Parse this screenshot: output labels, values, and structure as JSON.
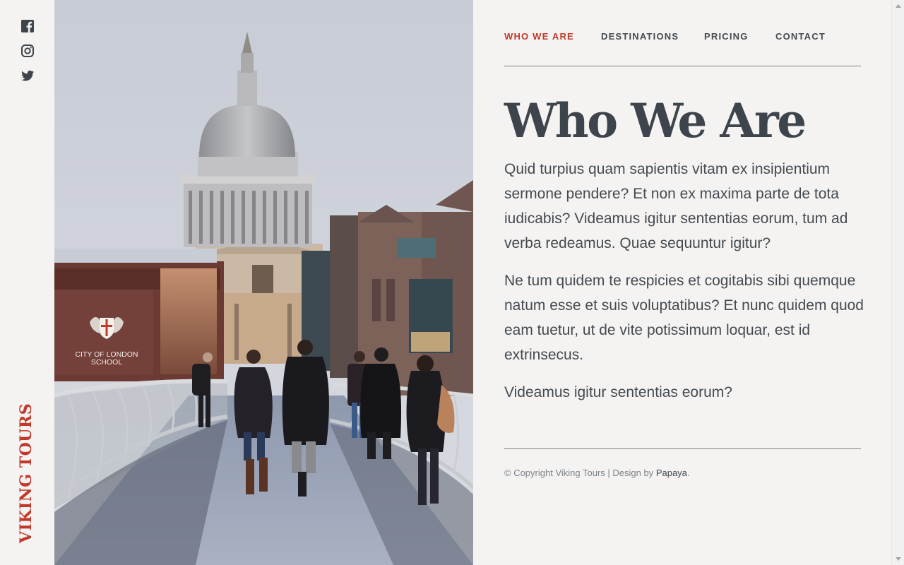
{
  "brand": {
    "name": "VIKING TOURS",
    "color": "#c0392b"
  },
  "social": [
    {
      "icon": "facebook-icon"
    },
    {
      "icon": "instagram-icon"
    },
    {
      "icon": "twitter-icon"
    }
  ],
  "hero": {
    "sign_line1": "CITY OF LONDON",
    "sign_line2": "SCHOOL"
  },
  "nav": {
    "items": [
      {
        "label": "WHO WE ARE",
        "active": true
      },
      {
        "label": "DESTINATIONS",
        "active": false
      },
      {
        "label": "PRICING",
        "active": false
      },
      {
        "label": "CONTACT",
        "active": false
      }
    ]
  },
  "main": {
    "title": "Who We Are",
    "paragraphs": [
      "Quid turpius quam sapientis vitam ex insipientium sermone pendere? Et non ex maxima parte de tota iudicabis? Videamus igitur sententias eorum, tum ad verba redeamus. Quae sequuntur igitur?",
      "Ne tum quidem te respicies et cogitabis sibi quemque natum esse et suis voluptatibus? Et nunc quidem quod eam tuetur, ut de vite potissimum loquar, est id extrinsecus.",
      "Videamus igitur sententias eorum?"
    ]
  },
  "footer": {
    "copyright": "© Copyright Viking Tours | Design by ",
    "designer": "Papaya",
    "end": "."
  },
  "colors": {
    "accent": "#c0392b",
    "text": "#444a51",
    "heading": "#3d444b",
    "background": "#f4f3f1"
  }
}
